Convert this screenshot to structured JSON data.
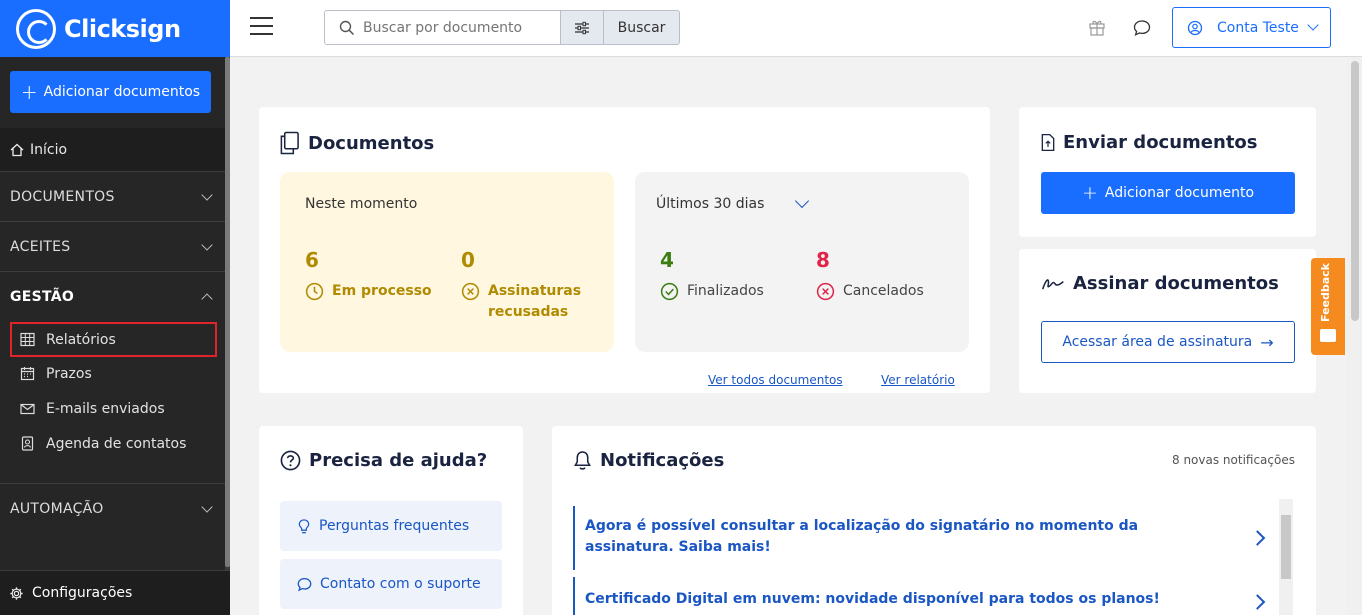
{
  "brand": {
    "name": "Clicksign"
  },
  "sidebar": {
    "add_button": "Adicionar documentos",
    "home": "Início",
    "sections": {
      "documentos": "DOCUMENTOS",
      "aceites": "ACEITES",
      "gestao": "GESTÃO",
      "automacao": "AUTOMAÇÃO"
    },
    "gestao_items": [
      "Relatórios",
      "Prazos",
      "E-mails enviados",
      "Agenda de contatos"
    ],
    "config": "Configurações"
  },
  "topbar": {
    "search_placeholder": "Buscar por documento",
    "search_button": "Buscar",
    "account": "Conta Teste"
  },
  "documents": {
    "title": "Documentos",
    "now_label": "Neste momento",
    "in_process_count": "6",
    "in_process_label": "Em processo",
    "refused_count": "0",
    "refused_label": "Assinaturas recusadas",
    "period_label": "Últimos 30 dias",
    "finished_count": "4",
    "finished_label": "Finalizados",
    "cancelled_count": "8",
    "cancelled_label": "Cancelados",
    "see_all": "Ver todos documentos",
    "see_report": "Ver relatório"
  },
  "send": {
    "title": "Enviar documentos",
    "button": "Adicionar documento"
  },
  "sign": {
    "title": "Assinar documentos",
    "button": "Acessar área de assinatura"
  },
  "feedback": "Feedback",
  "help": {
    "title": "Precisa de ajuda?",
    "items": [
      "Perguntas frequentes",
      "Contato com o suporte"
    ]
  },
  "notifications": {
    "title": "Notificações",
    "count": "8 novas notificações",
    "items": [
      "Agora é possível consultar a localização do signatário no momento da assinatura. Saiba mais!",
      "Certificado Digital em nuvem: novidade disponível para todos os planos!"
    ]
  },
  "colors": {
    "primary": "#1a6eff",
    "sidebar": "#262626",
    "highlight": "#e0242a",
    "feedback": "#f58a1f"
  }
}
